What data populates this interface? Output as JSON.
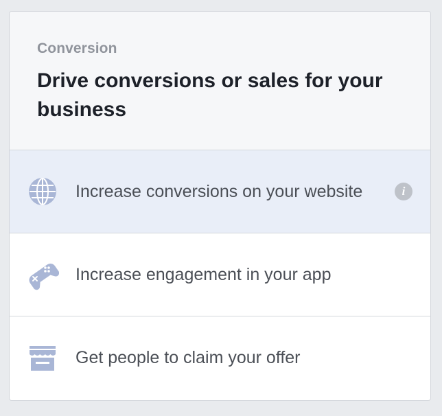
{
  "header": {
    "category": "Conversion",
    "title": "Drive conversions or sales for your business"
  },
  "options": [
    {
      "label": "Increase conversions on your website",
      "icon": "globe-icon",
      "selected": true,
      "has_info": true
    },
    {
      "label": "Increase engagement in your app",
      "icon": "gamepad-icon",
      "selected": false,
      "has_info": false
    },
    {
      "label": "Get people to claim your offer",
      "icon": "storefront-icon",
      "selected": false,
      "has_info": false
    }
  ],
  "info_glyph": "i",
  "colors": {
    "icon": "#a9b6d6",
    "selected_bg": "#e9eef8",
    "header_bg": "#f6f7f9",
    "title": "#1d2129",
    "category": "#90949c",
    "label": "#4b4f56",
    "info_bg": "#bec2c9"
  }
}
